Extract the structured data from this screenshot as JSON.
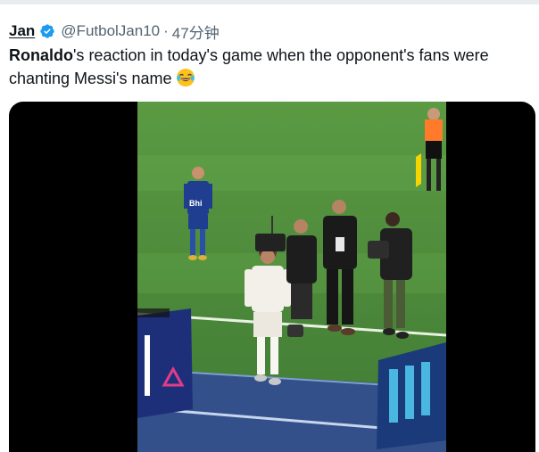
{
  "tweet": {
    "author_name": "Jan",
    "handle": "@FutbolJan10",
    "separator": "·",
    "time": "47分钟",
    "text_bold": "Ronaldo",
    "text_rest": "'s reaction in today's game when the opponent's fans were chanting Messi's name",
    "emoji": "face-with-tears-of-joy"
  },
  "media": {
    "type": "video",
    "player_shirt_text": "Bhi"
  },
  "colors": {
    "verified": "#1d9bf0",
    "pitch": "#4f8a3c",
    "away_kit": "#1f3e8f",
    "home_kit": "#f3f0ea"
  }
}
